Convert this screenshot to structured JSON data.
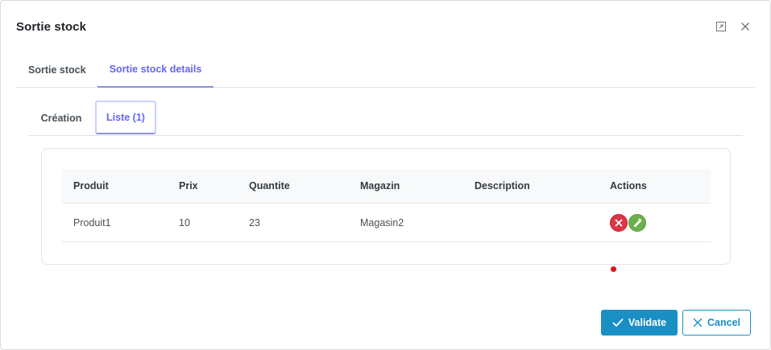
{
  "dialog": {
    "title": "Sortie stock"
  },
  "outer_tabs": [
    {
      "label": "Sortie stock",
      "active": false
    },
    {
      "label": "Sortie stock details",
      "active": true
    }
  ],
  "inner_tabs": [
    {
      "label": "Création",
      "active": false
    },
    {
      "label": "Liste (1)",
      "active": true
    }
  ],
  "table": {
    "headers": [
      "Produit",
      "Prix",
      "Quantite",
      "Magazin",
      "Description",
      "Actions"
    ],
    "rows": [
      {
        "produit": "Produit1",
        "prix": "10",
        "quantite": "23",
        "magazin": "Magasin2",
        "description": ""
      }
    ]
  },
  "footer": {
    "validate_label": "Validate",
    "cancel_label": "Cancel"
  },
  "colors": {
    "accent": "#6366f1",
    "primary": "#1a8fc4",
    "delete": "#dc3545",
    "edit": "#6ab04c"
  },
  "icons": [
    "maximize-icon",
    "close-icon",
    "times-icon",
    "pencil-icon",
    "check-icon"
  ]
}
